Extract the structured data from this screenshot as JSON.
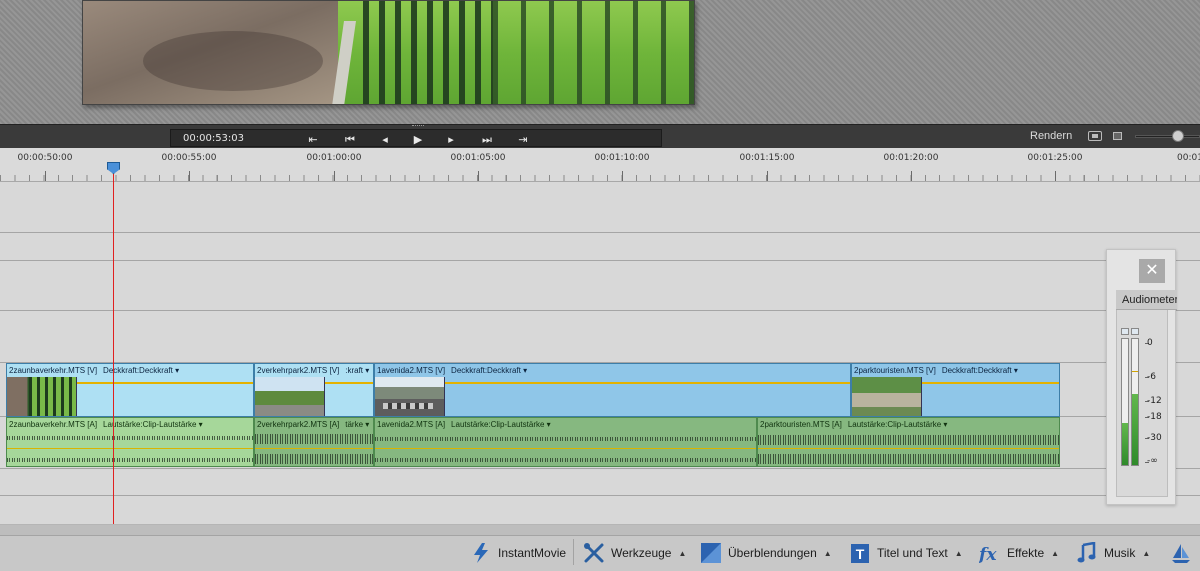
{
  "transport": {
    "timecode": "00:00:53:03",
    "render_label": "Rendern",
    "buttons": {
      "go_start": "⇤",
      "prev_edit": "⏮",
      "step_back": "◂",
      "play": "▶",
      "step_forward": "▸",
      "next_edit": "⏭",
      "go_end": "⇥"
    },
    "zoom_level": 0.7
  },
  "ruler": {
    "labels": [
      "00:00:50:00",
      "00:00:55:00",
      "00:01:00:00",
      "00:01:05:00",
      "00:01:10:00",
      "00:01:15:00",
      "00:01:20:00",
      "00:01:25:00",
      "00:01"
    ]
  },
  "playhead": {
    "time": "00:00:53:03"
  },
  "video_clips": [
    {
      "name": "2zaunbaverkehr.MTS [V]",
      "property": "Deckkraft:Deckkraft ▾"
    },
    {
      "name": "2verkehrpark2.MTS [V]",
      "property": ":kraft ▾"
    },
    {
      "name": "1avenida2.MTS [V]",
      "property": "Deckkraft:Deckkraft ▾"
    },
    {
      "name": "2parktouristen.MTS [V]",
      "property": "Deckkraft:Deckkraft ▾"
    }
  ],
  "audio_clips": [
    {
      "name": "2zaunbaverkehr.MTS [A]",
      "property": "Lautstärke:Clip-Lautstärke ▾"
    },
    {
      "name": "2verkehrpark2.MTS [A]",
      "property": "tärke ▾"
    },
    {
      "name": "1avenida2.MTS [A]",
      "property": "Lautstärke:Clip-Lautstärke ▾"
    },
    {
      "name": "2parktouristen.MTS [A]",
      "property": "Lautstärke:Clip-Lautstärke ▾"
    }
  ],
  "audio_meter": {
    "title": "Audiometer",
    "close": "✕",
    "scale": [
      "0",
      "-6",
      "-12",
      "-18",
      "-30",
      "-∞"
    ],
    "left_level": 0.33,
    "right_level": 0.56,
    "colors": {
      "fill": "#3f9c36",
      "peak_marker": "#d1a300"
    }
  },
  "bottom_bar": {
    "instantmovie": "InstantMovie",
    "werkzeuge": "Werkzeuge",
    "ueberblendungen": "Überblendungen",
    "titel": "Titel und Text",
    "effekte": "Effekte",
    "musik": "Musik",
    "caret": "▲"
  },
  "colors": {
    "video_clip": "#8fc6e8",
    "audio_clip": "#a6d79a",
    "playhead": "#e02020",
    "opacity_line": "#e4b200"
  }
}
